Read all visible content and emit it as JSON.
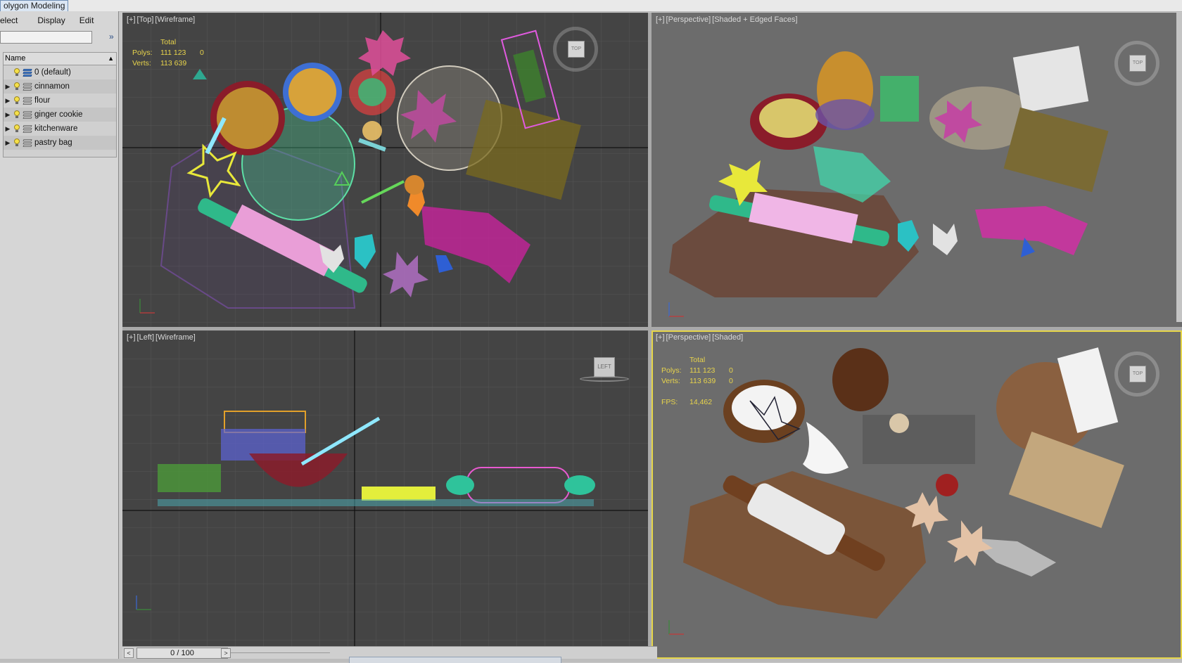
{
  "ribbon": {
    "active_tab": "olygon Modeling"
  },
  "scene_explorer": {
    "menu": [
      "elect",
      "Display",
      "Edit"
    ],
    "search_placeholder": "",
    "expand_label": "»",
    "column_header": "Name",
    "layers": [
      {
        "label": "0 (default)",
        "has_children": false,
        "is_default": true
      },
      {
        "label": "cinnamon",
        "has_children": true,
        "is_default": false
      },
      {
        "label": "flour",
        "has_children": true,
        "is_default": false
      },
      {
        "label": "ginger cookie",
        "has_children": true,
        "is_default": false
      },
      {
        "label": "kitchenware",
        "has_children": true,
        "is_default": false
      },
      {
        "label": "pastry bag",
        "has_children": true,
        "is_default": false
      }
    ]
  },
  "viewports": {
    "top": {
      "plus": "[+]",
      "view": "[Top]",
      "mode": "[Wireframe]",
      "cube_face": "TOP"
    },
    "perspective_edged": {
      "plus": "[+]",
      "view": "[Perspective]",
      "mode": "[Shaded + Edged Faces]",
      "cube_face": "TOP"
    },
    "left": {
      "plus": "[+]",
      "view": "[Left]",
      "mode": "[Wireframe]",
      "cube_face": "LEFT"
    },
    "perspective_shaded": {
      "plus": "[+]",
      "view": "[Perspective]",
      "mode": "[Shaded]",
      "cube_face": "TOP"
    }
  },
  "stats": {
    "total_label": "Total",
    "polys_label": "Polys:",
    "polys_value": "111 123",
    "polys_sel": "0",
    "verts_label": "Verts:",
    "verts_value": "113 639",
    "verts_sel": "0",
    "fps_label": "FPS:",
    "fps_value": "14,462"
  },
  "timeslider": {
    "frame": "0 / 100",
    "prev": "<",
    "next": ">"
  },
  "colors": {
    "stats_text": "#e8d44c",
    "active_border": "#e6d64a",
    "viewport_dark": "#444444",
    "viewport_mid": "#6c6c6c"
  }
}
